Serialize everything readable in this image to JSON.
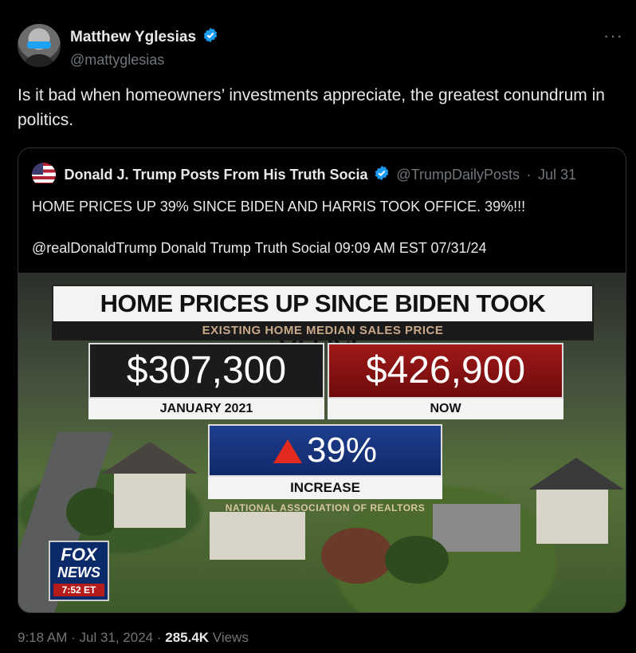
{
  "author": {
    "display_name": "Matthew Yglesias",
    "handle": "@mattyglesias",
    "verified": true
  },
  "more_icon": "···",
  "tweet": {
    "text": "Is it bad when homeowners’ investments appreciate, the greatest conundrum in politics."
  },
  "quote": {
    "display_name": "Donald J. Trump Posts From His Truth Socia",
    "handle": "@TrumpDailyPosts",
    "separator": "·",
    "date": "Jul 31",
    "verified": true,
    "line1": "HOME PRICES UP 39% SINCE BIDEN AND HARRIS TOOK OFFICE. 39%!!!",
    "line2": "@realDonaldTrump Donald Trump Truth Social 09:09 AM EST 07/31/24",
    "media": {
      "headline": "HOME PRICES UP SINCE BIDEN TOOK OFFICE",
      "subheadline": "EXISTING HOME MEDIAN SALES PRICE",
      "left_value": "$307,300",
      "left_label": "JANUARY 2021",
      "right_value": "$426,900",
      "right_label": "NOW",
      "change_value": "39%",
      "change_label": "INCREASE",
      "source": "NATIONAL ASSOCIATION OF REALTORS",
      "network_line1": "FOX",
      "network_line2": "NEWS",
      "network_time": "7:52 ET"
    }
  },
  "footer": {
    "time": "9:18 AM",
    "separator": " · ",
    "date": "Jul 31, 2024",
    "views_count": "285.4K",
    "views_label": " Views"
  },
  "colors": {
    "background": "#000000",
    "text": "#e7e9ea",
    "muted": "#71767b",
    "verified": "#1d9bf0",
    "border": "#2f3336"
  }
}
